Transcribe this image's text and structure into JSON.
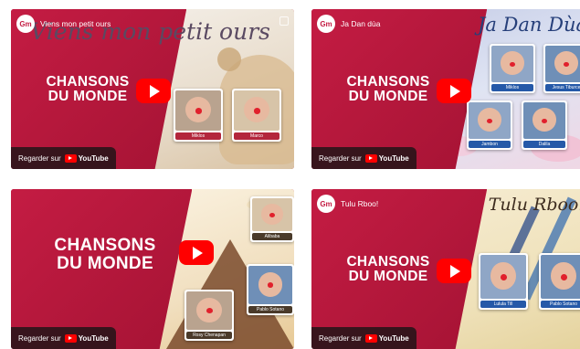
{
  "brand": {
    "channel_icon_text": "Gm",
    "line1": "CHANSONS",
    "line2": "DU MONDE",
    "watch_label": "Regarder sur",
    "youtube_label": "YouTube"
  },
  "videos": [
    {
      "title": "Viens mon petit ours",
      "art_title": "Viens mon petit ours",
      "characters": [
        "Miklos",
        "Marco"
      ]
    },
    {
      "title": "Ja Dan dùa",
      "art_title": "Ja Dan Dùa",
      "characters": [
        "Miklos",
        "Jesus Tiburce",
        "Jambon",
        "Dalila"
      ]
    },
    {
      "title": "",
      "art_title": "",
      "characters": [
        "Alibaba",
        "Rosy Chenapan",
        "Pablo Sotano"
      ]
    },
    {
      "title": "Tulu Rboo!",
      "art_title": "Tulu Rboo!",
      "characters": [
        "Lulula Till",
        "Pablo Sotano"
      ]
    }
  ],
  "colors": {
    "brand_red": "#c41c43",
    "youtube_red": "#ff0000"
  }
}
